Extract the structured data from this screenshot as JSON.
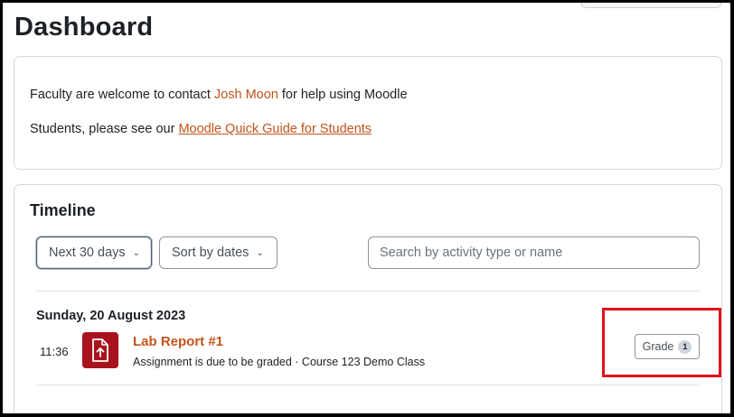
{
  "page": {
    "title": "Dashboard"
  },
  "welcome": {
    "line1_prefix": "Faculty are welcome to contact ",
    "line1_link": "Josh Moon",
    "line1_suffix": " for help using Moodle",
    "line2_prefix": "Students, please see our ",
    "line2_link": "Moodle Quick Guide for Students"
  },
  "timeline": {
    "title": "Timeline",
    "filter_label": "Next 30 days",
    "sort_label": "Sort by dates",
    "search_placeholder": "Search by activity type or name",
    "groups": [
      {
        "date": "Sunday, 20 August 2023",
        "events": [
          {
            "time": "11:36",
            "icon": "assignment-upload-icon",
            "name": "Lab Report #1",
            "meta": "Assignment is due to be graded · Course 123 Demo Class",
            "action_label": "Grade",
            "action_count": "1"
          }
        ]
      }
    ]
  },
  "colors": {
    "link": "#c2541b",
    "assignment_icon_bg": "#a8121e",
    "highlight_border": "#e2121b"
  }
}
